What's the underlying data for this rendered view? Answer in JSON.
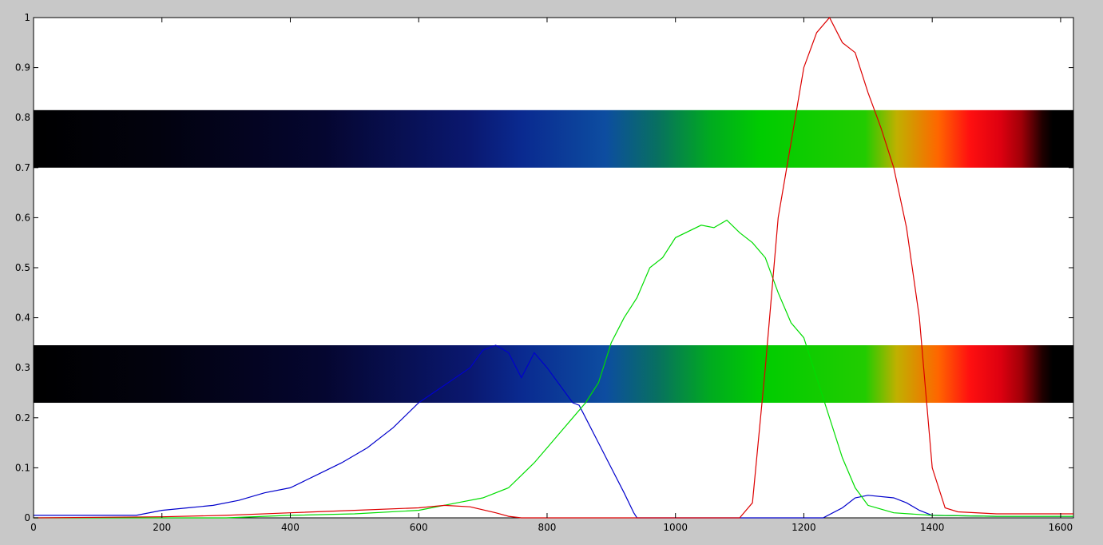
{
  "chart_data": {
    "type": "line",
    "title": "",
    "xlabel": "",
    "ylabel": "",
    "xlim": [
      0,
      1620
    ],
    "ylim": [
      0,
      1
    ],
    "grid": false,
    "x_ticks": [
      0,
      200,
      400,
      600,
      800,
      1000,
      1200,
      1400,
      1600
    ],
    "y_ticks": [
      0,
      0.1,
      0.2,
      0.3,
      0.4,
      0.5,
      0.6,
      0.7,
      0.8,
      0.9,
      1
    ],
    "bands": [
      {
        "y_from": 0.7,
        "y_to": 0.815
      },
      {
        "y_from": 0.23,
        "y_to": 0.345
      }
    ],
    "series": [
      {
        "color": "#0000cc",
        "x": [
          0,
          160,
          200,
          240,
          280,
          320,
          360,
          400,
          440,
          480,
          520,
          560,
          600,
          640,
          680,
          700,
          720,
          740,
          760,
          780,
          800,
          840,
          850,
          860,
          880,
          900,
          920,
          935,
          940,
          1000,
          1100,
          1230,
          1260,
          1280,
          1300,
          1340,
          1360,
          1380,
          1400,
          1500,
          1620
        ],
        "y": [
          0.005,
          0.005,
          0.015,
          0.02,
          0.025,
          0.035,
          0.05,
          0.06,
          0.085,
          0.11,
          0.14,
          0.18,
          0.23,
          0.265,
          0.3,
          0.335,
          0.345,
          0.33,
          0.28,
          0.33,
          0.3,
          0.23,
          0.225,
          0.2,
          0.15,
          0.1,
          0.05,
          0.01,
          0.0,
          0.0,
          0.0,
          0.0,
          0.02,
          0.04,
          0.045,
          0.04,
          0.03,
          0.015,
          0.005,
          0.003,
          0.003
        ]
      },
      {
        "color": "#00dd00",
        "x": [
          0,
          300,
          400,
          500,
          600,
          660,
          700,
          740,
          760,
          780,
          800,
          820,
          840,
          860,
          880,
          900,
          920,
          940,
          960,
          980,
          1000,
          1040,
          1060,
          1080,
          1100,
          1120,
          1140,
          1160,
          1180,
          1200,
          1220,
          1240,
          1260,
          1280,
          1300,
          1340,
          1400,
          1500,
          1620
        ],
        "y": [
          0.0,
          0.0,
          0.005,
          0.008,
          0.015,
          0.03,
          0.04,
          0.06,
          0.085,
          0.11,
          0.14,
          0.17,
          0.2,
          0.23,
          0.27,
          0.35,
          0.4,
          0.44,
          0.5,
          0.52,
          0.56,
          0.585,
          0.58,
          0.595,
          0.57,
          0.55,
          0.52,
          0.45,
          0.39,
          0.36,
          0.28,
          0.2,
          0.12,
          0.06,
          0.025,
          0.01,
          0.005,
          0.003,
          0.003
        ]
      },
      {
        "color": "#dd0000",
        "x": [
          0,
          200,
          300,
          400,
          500,
          600,
          640,
          680,
          720,
          740,
          760,
          1000,
          1100,
          1120,
          1140,
          1160,
          1180,
          1200,
          1220,
          1240,
          1260,
          1280,
          1300,
          1320,
          1340,
          1360,
          1380,
          1400,
          1420,
          1440,
          1500,
          1620
        ],
        "y": [
          0.0,
          0.002,
          0.005,
          0.01,
          0.015,
          0.02,
          0.025,
          0.022,
          0.01,
          0.003,
          0.0,
          0.0,
          0.0,
          0.03,
          0.3,
          0.6,
          0.75,
          0.9,
          0.97,
          1.0,
          0.95,
          0.93,
          0.85,
          0.78,
          0.7,
          0.58,
          0.4,
          0.1,
          0.02,
          0.012,
          0.008,
          0.008
        ]
      }
    ]
  }
}
